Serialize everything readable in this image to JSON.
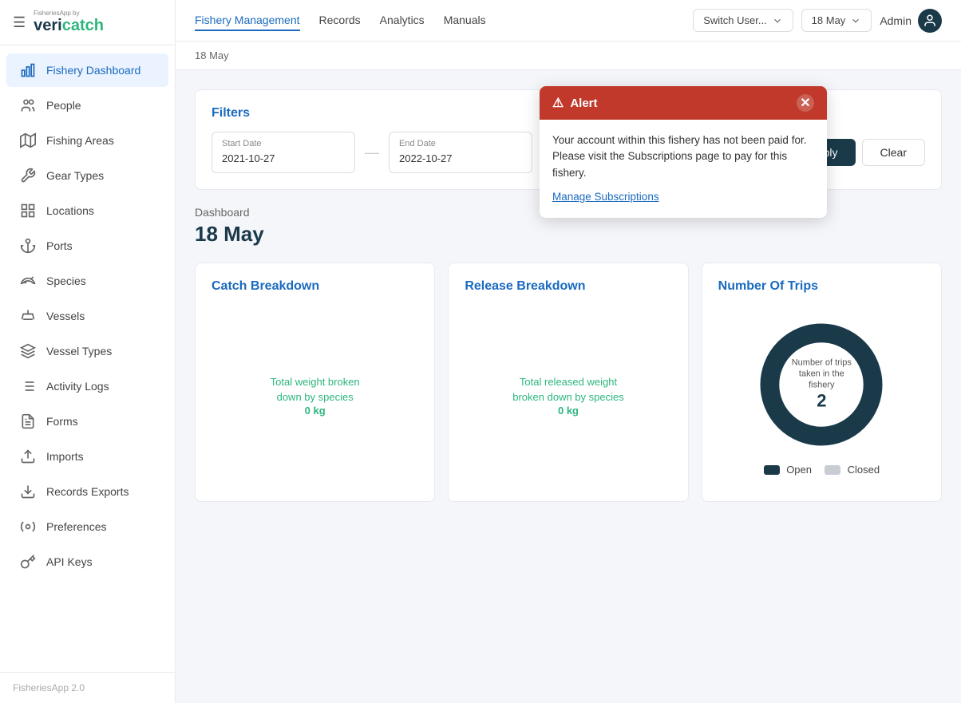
{
  "app": {
    "logo_small": "FisheriesApp by",
    "logo_main": "vericatch",
    "version": "FisheriesApp 2.0"
  },
  "topnav": {
    "items": [
      {
        "label": "Fishery Management",
        "active": true
      },
      {
        "label": "Records",
        "active": false
      },
      {
        "label": "Analytics",
        "active": false
      },
      {
        "label": "Manuals",
        "active": false
      }
    ],
    "switch_user_label": "Switch User...",
    "date_label": "18 May",
    "admin_label": "Admin"
  },
  "subheader": {
    "date": "18 May"
  },
  "alert": {
    "title": "Alert",
    "body": "Your account within this fishery has not been paid for. Please visit the Subscriptions page to pay for this fishery.",
    "link_label": "Manage Subscriptions"
  },
  "filters": {
    "title": "Filters",
    "start_date_label": "Start Date",
    "start_date_value": "2021-10-27",
    "end_date_label": "End Date",
    "end_date_value": "2022-10-27",
    "apply_label": "Apply",
    "clear_label": "Clear"
  },
  "dashboard": {
    "label": "Dashboard",
    "date": "18 May"
  },
  "cards": {
    "catch_breakdown": {
      "title": "Catch Breakdown",
      "sub_label": "Total weight broken\ndown by species",
      "value": "0 kg"
    },
    "release_breakdown": {
      "title": "Release Breakdown",
      "sub_label": "Total released weight\nbroken down by species",
      "value": "0 kg"
    },
    "number_of_trips": {
      "title": "Number Of Trips",
      "center_label": "Number of trips taken\nin the fishery",
      "center_value": "2",
      "legend": [
        {
          "label": "Open",
          "color": "#1a3a4a"
        },
        {
          "label": "Closed",
          "color": "#c8cdd4"
        }
      ]
    }
  },
  "sidebar": {
    "items": [
      {
        "id": "fishery-dashboard",
        "label": "Fishery Dashboard",
        "active": true
      },
      {
        "id": "people",
        "label": "People",
        "active": false
      },
      {
        "id": "fishing-areas",
        "label": "Fishing Areas",
        "active": false
      },
      {
        "id": "gear-types",
        "label": "Gear Types",
        "active": false
      },
      {
        "id": "locations",
        "label": "Locations",
        "active": false
      },
      {
        "id": "ports",
        "label": "Ports",
        "active": false
      },
      {
        "id": "species",
        "label": "Species",
        "active": false
      },
      {
        "id": "vessels",
        "label": "Vessels",
        "active": false
      },
      {
        "id": "vessel-types",
        "label": "Vessel Types",
        "active": false
      },
      {
        "id": "activity-logs",
        "label": "Activity Logs",
        "active": false
      },
      {
        "id": "forms",
        "label": "Forms",
        "active": false
      },
      {
        "id": "imports",
        "label": "Imports",
        "active": false
      },
      {
        "id": "records-exports",
        "label": "Records Exports",
        "active": false
      },
      {
        "id": "preferences",
        "label": "Preferences",
        "active": false
      },
      {
        "id": "api-keys",
        "label": "API Keys",
        "active": false
      }
    ]
  }
}
